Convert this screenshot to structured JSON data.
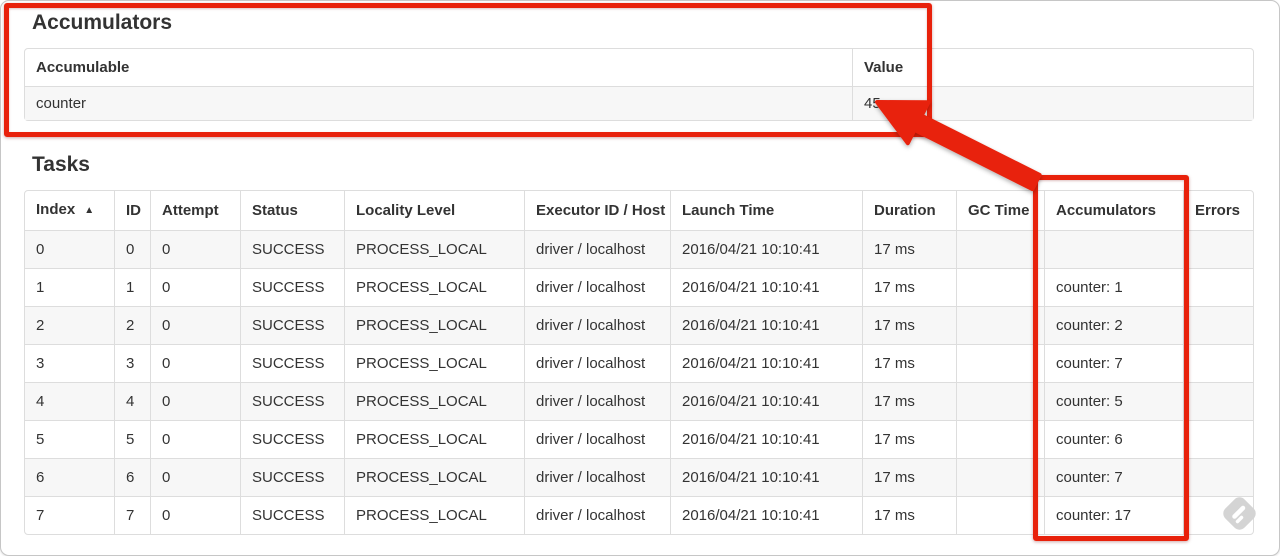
{
  "accumulators_section": {
    "title": "Accumulators",
    "table": {
      "headers": {
        "accumulable": "Accumulable",
        "value": "Value"
      },
      "row": {
        "accumulable": "counter",
        "value": "45"
      }
    }
  },
  "tasks_section": {
    "title": "Tasks",
    "table": {
      "sort_icon": "▲",
      "columns": [
        {
          "key": "index",
          "label": "Index",
          "sorted": true
        },
        {
          "key": "id",
          "label": "ID"
        },
        {
          "key": "attempt",
          "label": "Attempt"
        },
        {
          "key": "status",
          "label": "Status"
        },
        {
          "key": "locality_level",
          "label": "Locality Level"
        },
        {
          "key": "executor_id_host",
          "label": "Executor ID / Host"
        },
        {
          "key": "launch_time",
          "label": "Launch Time"
        },
        {
          "key": "duration",
          "label": "Duration"
        },
        {
          "key": "gc_time",
          "label": "GC Time"
        },
        {
          "key": "accumulators",
          "label": "Accumulators"
        },
        {
          "key": "errors",
          "label": "Errors"
        }
      ],
      "rows": [
        {
          "index": "0",
          "id": "0",
          "attempt": "0",
          "status": "SUCCESS",
          "locality_level": "PROCESS_LOCAL",
          "executor_id_host": "driver / localhost",
          "launch_time": "2016/04/21 10:10:41",
          "duration": "17 ms",
          "gc_time": "",
          "accumulators": "",
          "errors": ""
        },
        {
          "index": "1",
          "id": "1",
          "attempt": "0",
          "status": "SUCCESS",
          "locality_level": "PROCESS_LOCAL",
          "executor_id_host": "driver / localhost",
          "launch_time": "2016/04/21 10:10:41",
          "duration": "17 ms",
          "gc_time": "",
          "accumulators": "counter: 1",
          "errors": ""
        },
        {
          "index": "2",
          "id": "2",
          "attempt": "0",
          "status": "SUCCESS",
          "locality_level": "PROCESS_LOCAL",
          "executor_id_host": "driver / localhost",
          "launch_time": "2016/04/21 10:10:41",
          "duration": "17 ms",
          "gc_time": "",
          "accumulators": "counter: 2",
          "errors": ""
        },
        {
          "index": "3",
          "id": "3",
          "attempt": "0",
          "status": "SUCCESS",
          "locality_level": "PROCESS_LOCAL",
          "executor_id_host": "driver / localhost",
          "launch_time": "2016/04/21 10:10:41",
          "duration": "17 ms",
          "gc_time": "",
          "accumulators": "counter: 7",
          "errors": ""
        },
        {
          "index": "4",
          "id": "4",
          "attempt": "0",
          "status": "SUCCESS",
          "locality_level": "PROCESS_LOCAL",
          "executor_id_host": "driver / localhost",
          "launch_time": "2016/04/21 10:10:41",
          "duration": "17 ms",
          "gc_time": "",
          "accumulators": "counter: 5",
          "errors": ""
        },
        {
          "index": "5",
          "id": "5",
          "attempt": "0",
          "status": "SUCCESS",
          "locality_level": "PROCESS_LOCAL",
          "executor_id_host": "driver / localhost",
          "launch_time": "2016/04/21 10:10:41",
          "duration": "17 ms",
          "gc_time": "",
          "accumulators": "counter: 6",
          "errors": ""
        },
        {
          "index": "6",
          "id": "6",
          "attempt": "0",
          "status": "SUCCESS",
          "locality_level": "PROCESS_LOCAL",
          "executor_id_host": "driver / localhost",
          "launch_time": "2016/04/21 10:10:41",
          "duration": "17 ms",
          "gc_time": "",
          "accumulators": "counter: 7",
          "errors": ""
        },
        {
          "index": "7",
          "id": "7",
          "attempt": "0",
          "status": "SUCCESS",
          "locality_level": "PROCESS_LOCAL",
          "executor_id_host": "driver / localhost",
          "launch_time": "2016/04/21 10:10:41",
          "duration": "17 ms",
          "gc_time": "",
          "accumulators": "counter: 17",
          "errors": ""
        }
      ]
    }
  },
  "annotations": {
    "color": "#e8210b",
    "highlighted_value": "45"
  },
  "watermark": {
    "icon": "skitch-watermark-icon",
    "color": "#d4d4d4"
  }
}
